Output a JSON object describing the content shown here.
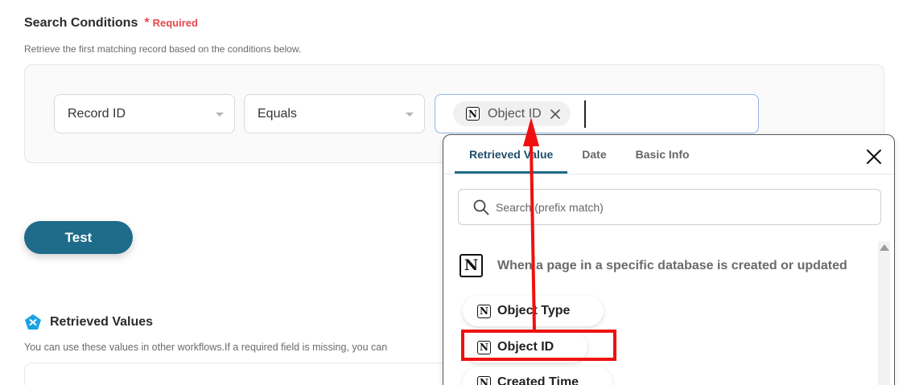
{
  "search_conditions": {
    "title": "Search Conditions",
    "required_mark": "*",
    "required_label": "Required",
    "description": "Retrieve the first matching record based on the conditions below.",
    "field_select": "Record ID",
    "operator_select": "Equals",
    "value_chip": "Object ID"
  },
  "test_button": "Test",
  "retrieved_values": {
    "title": "Retrieved Values",
    "description": "You can use these values in other workflows.If a required field is missing, you can"
  },
  "popup": {
    "tabs": [
      {
        "label": "Retrieved Value",
        "active": true
      },
      {
        "label": "Date",
        "active": false
      },
      {
        "label": "Basic Info",
        "active": false
      }
    ],
    "search_placeholder": "Search (prefix match)",
    "source_label": "When a page in a specific database is created or updated",
    "items": [
      {
        "label": "Object Type"
      },
      {
        "label": "Object ID"
      },
      {
        "label": "Created Time"
      }
    ]
  },
  "icons": {
    "notion": "N",
    "close": "close-icon",
    "search": "search-icon",
    "retrieved_values": "retrieved-values-icon"
  },
  "colors": {
    "accent": "#1f6b8a",
    "required": "#e5484d",
    "annotation": "#f01010",
    "input_focus_border": "#8fb5e8"
  }
}
